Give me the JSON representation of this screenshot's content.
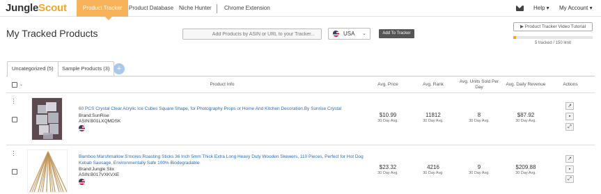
{
  "app": {
    "logo_jungle": "Jungle",
    "logo_scout": "Scout"
  },
  "nav": {
    "tabs": [
      {
        "label": "Product Tracker"
      },
      {
        "label": "Product Database"
      },
      {
        "label": "Niche Hunter"
      },
      {
        "label": "Chrome Extension"
      }
    ],
    "help": "Help ▾",
    "account": "My Account ▾"
  },
  "page": {
    "title": "My Tracked Products",
    "search_placeholder": "Add Products by ASIN or URL to your Tracker...",
    "country": "USA",
    "add_button": "Add To Tracker",
    "tutorial_button": "▶ Product Tracker Video Tutorial",
    "tracked_text": "5 tracked / 150 limit",
    "tracked_fraction": 0.033
  },
  "tabs": [
    {
      "label": "Uncategorized (5)"
    },
    {
      "label": "Sample Products (3)"
    }
  ],
  "table": {
    "headers": {
      "product_info": "Product Info",
      "avg_price": "Avg. Price",
      "avg_rank": "Avg. Rank",
      "avg_units": "Avg. Units Sold Per Day",
      "avg_revenue": "Avg. Daily Revenue",
      "actions": "Actions"
    },
    "rows": [
      {
        "title": "60 PCS Crystal Clear Acrylic Ice Cubes Square Shape, for Photography Props or Home And Kitchen Decoration.By Sunrise Crystal",
        "brand": "Brand:SunRise",
        "asin": "ASIN:B01LXQMDSK",
        "price": "$10.99",
        "price_sub": "30 Day Avg.",
        "rank": "11812",
        "rank_sub": "30 Day Avg.",
        "units": "8",
        "units_sub": "30 Day Avg.",
        "revenue": "$87.92",
        "revenue_sub": "30 Day Avg."
      },
      {
        "title": "Bamboo Marshmallow S'mores Roasting Sticks 36 Inch 5mm Thick Extra Long Heavy Duty Wooden Skewers, 110 Pieces, Perfect for Hot Dog Kebab Sausage, Environmentally Safe 100% Biodegradable",
        "brand": "Brand:Jungle Stix",
        "asin": "ASIN:B017VXKVXE",
        "price": "$23.32",
        "price_sub": "30 Day Avg.",
        "rank": "4216",
        "rank_sub": "30 Day Avg.",
        "units": "9",
        "units_sub": "30 Day Avg.",
        "revenue": "$209.88",
        "revenue_sub": "30 Day Avg."
      }
    ]
  },
  "icons": {
    "mail": "mail-icon",
    "flag": "us-flag-icon",
    "external": "external-link-icon",
    "trash": "trash-icon",
    "expand": "expand-icon"
  },
  "colors": {
    "accent": "#f5a623",
    "active_tab": "#f8b35a",
    "link": "#2a6db0"
  }
}
